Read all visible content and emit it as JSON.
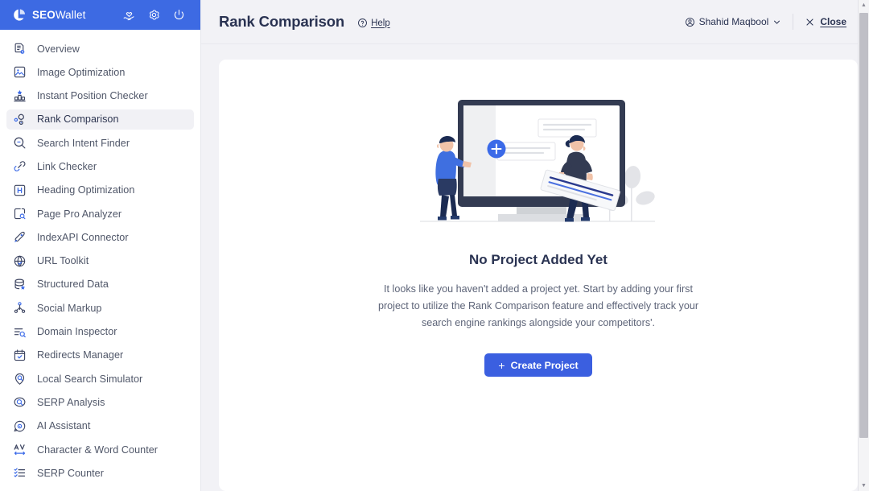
{
  "brand": {
    "name_bold": "SEO",
    "name_rest": "Wallet",
    "logo_icon": "pie-logo-icon",
    "icons": [
      {
        "name": "heart-in-hand-icon",
        "label": "Favorites"
      },
      {
        "name": "gear-icon",
        "label": "Settings"
      },
      {
        "name": "power-icon",
        "label": "Logout"
      }
    ]
  },
  "sidebar": {
    "items": [
      {
        "label": "Overview",
        "icon": "document-clock-icon",
        "active": false
      },
      {
        "label": "Image Optimization",
        "icon": "image-icon",
        "active": false
      },
      {
        "label": "Instant Position Checker",
        "icon": "bar-chart-star-icon",
        "active": false
      },
      {
        "label": "Rank Comparison",
        "icon": "rank-nodes-icon",
        "active": true
      },
      {
        "label": "Search Intent Finder",
        "icon": "search-icon",
        "active": false
      },
      {
        "label": "Link Checker",
        "icon": "link-icon",
        "active": false
      },
      {
        "label": "Heading Optimization",
        "icon": "heading-h-icon",
        "active": false
      },
      {
        "label": "Page Pro Analyzer",
        "icon": "page-search-icon",
        "active": false
      },
      {
        "label": "IndexAPI Connector",
        "icon": "rocket-icon",
        "active": false
      },
      {
        "label": "URL Toolkit",
        "icon": "globe-check-icon",
        "active": false
      },
      {
        "label": "Structured Data",
        "icon": "database-star-icon",
        "active": false
      },
      {
        "label": "Social Markup",
        "icon": "share-nodes-icon",
        "active": false
      },
      {
        "label": "Domain Inspector",
        "icon": "list-search-icon",
        "active": false
      },
      {
        "label": "Redirects Manager",
        "icon": "calendar-check-icon",
        "active": false
      },
      {
        "label": "Local Search Simulator",
        "icon": "location-search-icon",
        "active": false
      },
      {
        "label": "SERP Analysis",
        "icon": "serp-circle-icon",
        "active": false
      },
      {
        "label": "AI Assistant",
        "icon": "chat-gear-icon",
        "active": false
      },
      {
        "label": "Character & Word Counter",
        "icon": "av-arrows-icon",
        "active": false
      },
      {
        "label": "SERP Counter",
        "icon": "checklist-icon",
        "active": false
      }
    ]
  },
  "topbar": {
    "title": "Rank Comparison",
    "help_label": "Help",
    "help_icon": "question-circle-icon",
    "user_name": "Shahid Maqbool",
    "user_icon": "user-circle-icon",
    "user_chevron_icon": "chevron-down-icon",
    "close_label": "Close",
    "close_icon": "close-x-icon"
  },
  "empty_state": {
    "illustration": "people-adding-project-illustration",
    "title": "No Project Added Yet",
    "description": "It looks like you haven't added a project yet. Start by adding your first project to utilize the Rank Comparison feature and effectively track your search engine rankings alongside your competitors'.",
    "button_label": "Create Project",
    "button_icon": "plus-icon",
    "button_color": "#3b5fe0"
  },
  "colors": {
    "brand_blue": "#3d6ae3",
    "accent_blue": "#3b5fe0",
    "page_bg": "#f2f2f6",
    "card_bg": "#ffffff",
    "text_dark": "#2a3352",
    "text_muted": "#5d6478",
    "active_item_bg": "#f1f1f5"
  },
  "scrollbar": {
    "up_arrow_icon": "caret-up-icon",
    "down_arrow_icon": "caret-down-icon"
  }
}
